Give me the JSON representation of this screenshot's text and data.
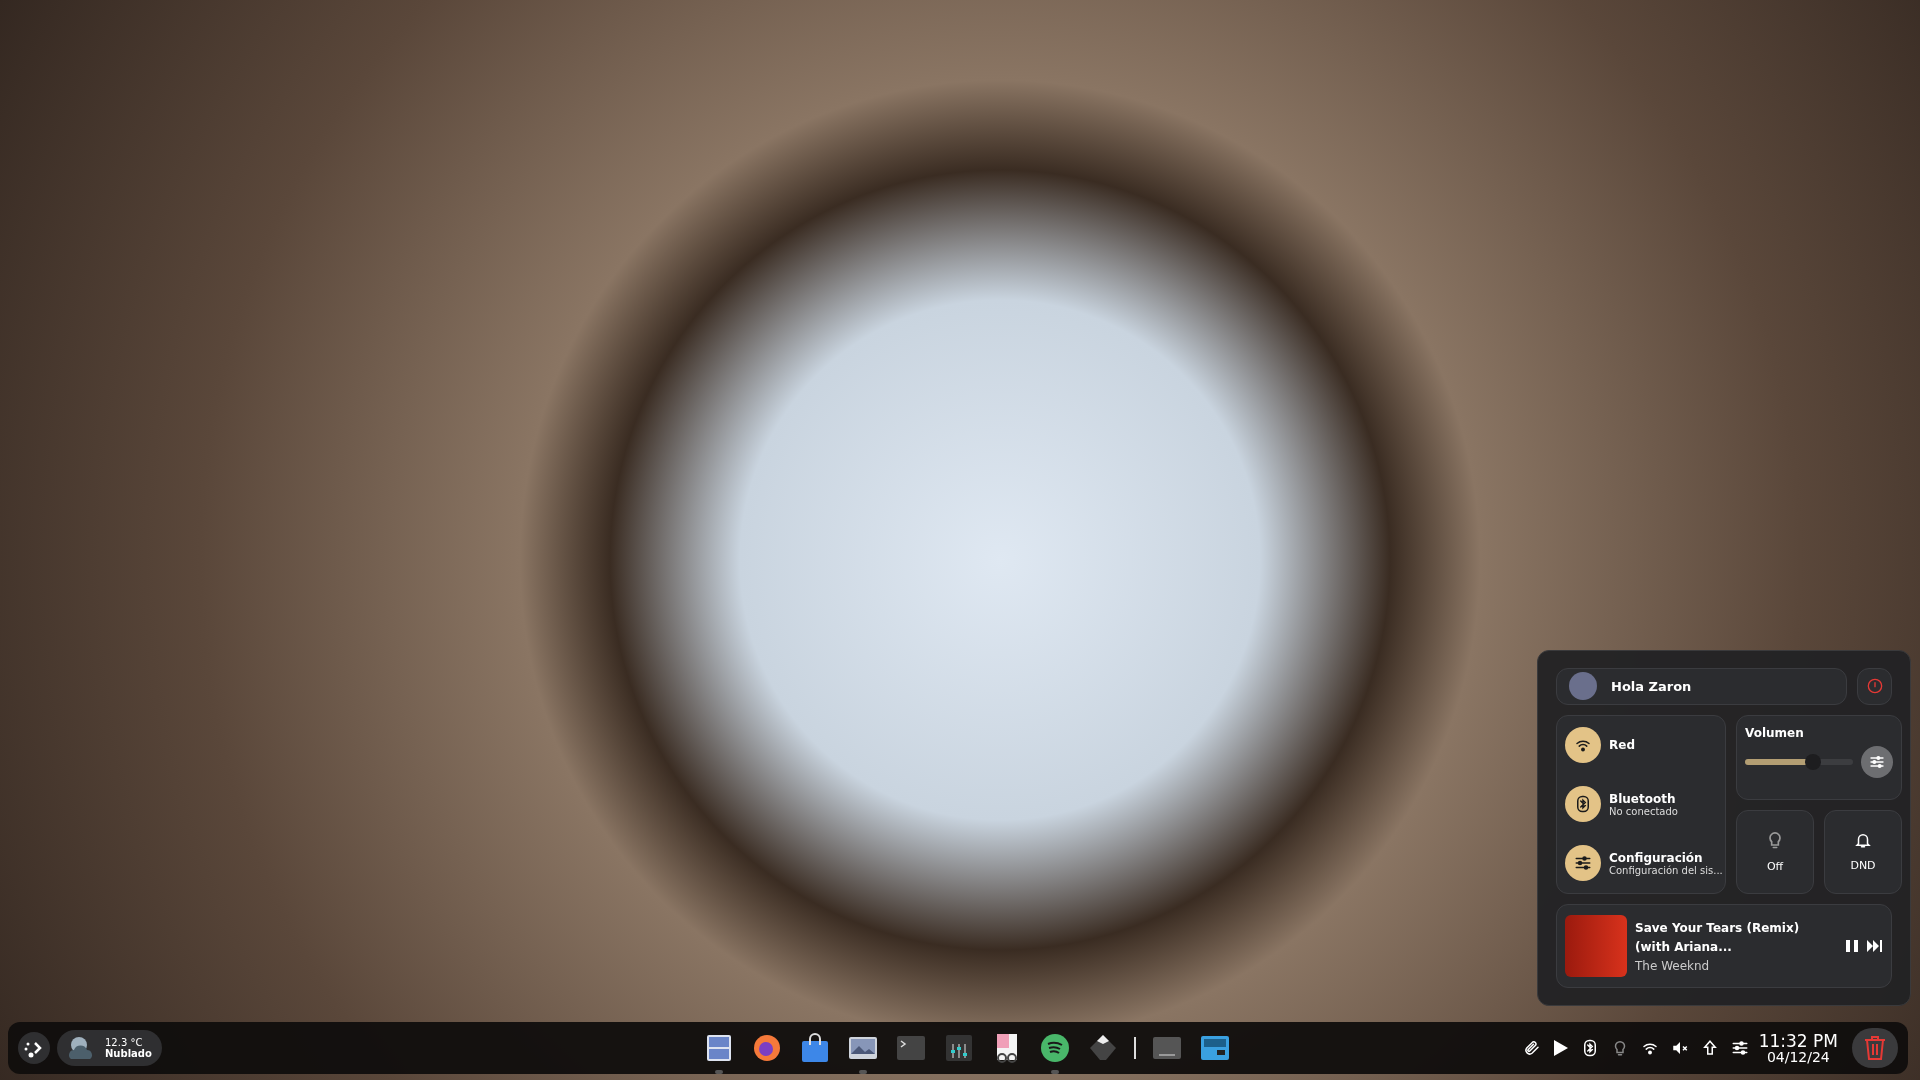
{
  "quick_settings": {
    "greeting": "Hola Zaron",
    "toggles": [
      {
        "kind": "wifi",
        "title": "Red"
      },
      {
        "kind": "bluetooth",
        "title": "Bluetooth",
        "subtitle": "No conectado"
      },
      {
        "kind": "settings",
        "title": "Configuración",
        "subtitle": "Configuración del sis..."
      }
    ],
    "volume": {
      "label": "Volumen",
      "level": 0.63
    },
    "tiles": [
      {
        "kind": "bulb",
        "label": "Off"
      },
      {
        "kind": "bell",
        "label": "DND"
      }
    ],
    "media": {
      "title": "Save Your Tears (Remix) (with Ariana...",
      "artist": "The Weeknd"
    }
  },
  "taskbar": {
    "weather": {
      "temperature": "12.3 °C",
      "condition": "Nublado"
    },
    "dock": [
      {
        "kind": "files",
        "running": true
      },
      {
        "kind": "browser",
        "running": false
      },
      {
        "kind": "store",
        "running": false
      },
      {
        "kind": "images",
        "running": true
      },
      {
        "kind": "terminal",
        "running": false
      },
      {
        "kind": "mixer",
        "running": false
      },
      {
        "kind": "document",
        "running": false
      },
      {
        "kind": "music",
        "running": true
      },
      {
        "kind": "mountain",
        "running": false
      },
      {
        "kind": "separator"
      },
      {
        "kind": "drive",
        "running": false
      },
      {
        "kind": "radio",
        "running": false
      }
    ],
    "tray": [
      {
        "kind": "clip"
      },
      {
        "kind": "play"
      },
      {
        "kind": "bluetooth"
      },
      {
        "kind": "bulb"
      },
      {
        "kind": "wifi"
      },
      {
        "kind": "mute"
      },
      {
        "kind": "upload"
      },
      {
        "kind": "sliders"
      }
    ],
    "clock": {
      "time": "11:32 PM",
      "date": "04/12/24"
    }
  }
}
